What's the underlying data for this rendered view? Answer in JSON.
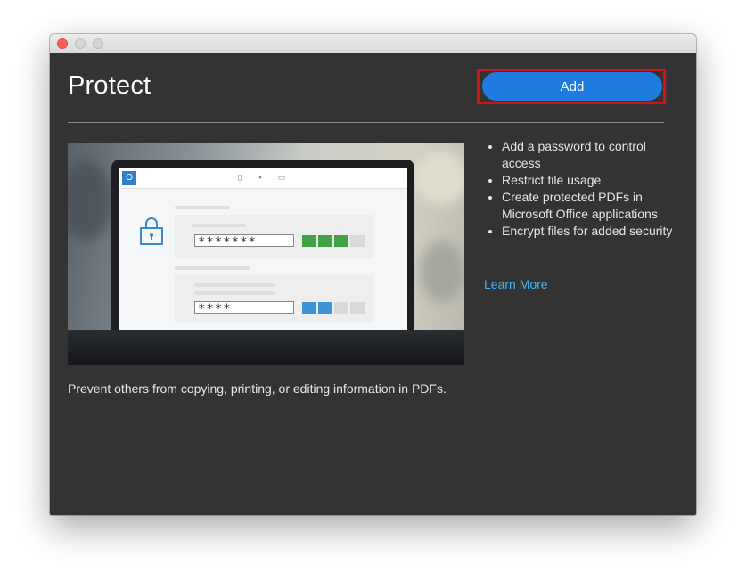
{
  "page": {
    "title": "Protect"
  },
  "header": {
    "add_label": "Add"
  },
  "hero": {
    "password_long": "*******",
    "password_short": "****",
    "strength_long": [
      "#43a047",
      "#43a047",
      "#43a047",
      "#d9d9d9"
    ],
    "strength_short": [
      "#3c94d8",
      "#3c94d8",
      "#d9d9d9",
      "#d9d9d9"
    ]
  },
  "caption": "Prevent others from copying, printing, or editing information in PDFs.",
  "features": [
    "Add a password to control access",
    "Restrict file usage",
    "Create protected PDFs in Microsoft Office applications",
    "Encrypt files for added security"
  ],
  "learn_more_label": "Learn More",
  "colors": {
    "accent": "#1e7be0",
    "highlight": "#d0141b",
    "link": "#4ab0f2",
    "background": "#333333"
  }
}
